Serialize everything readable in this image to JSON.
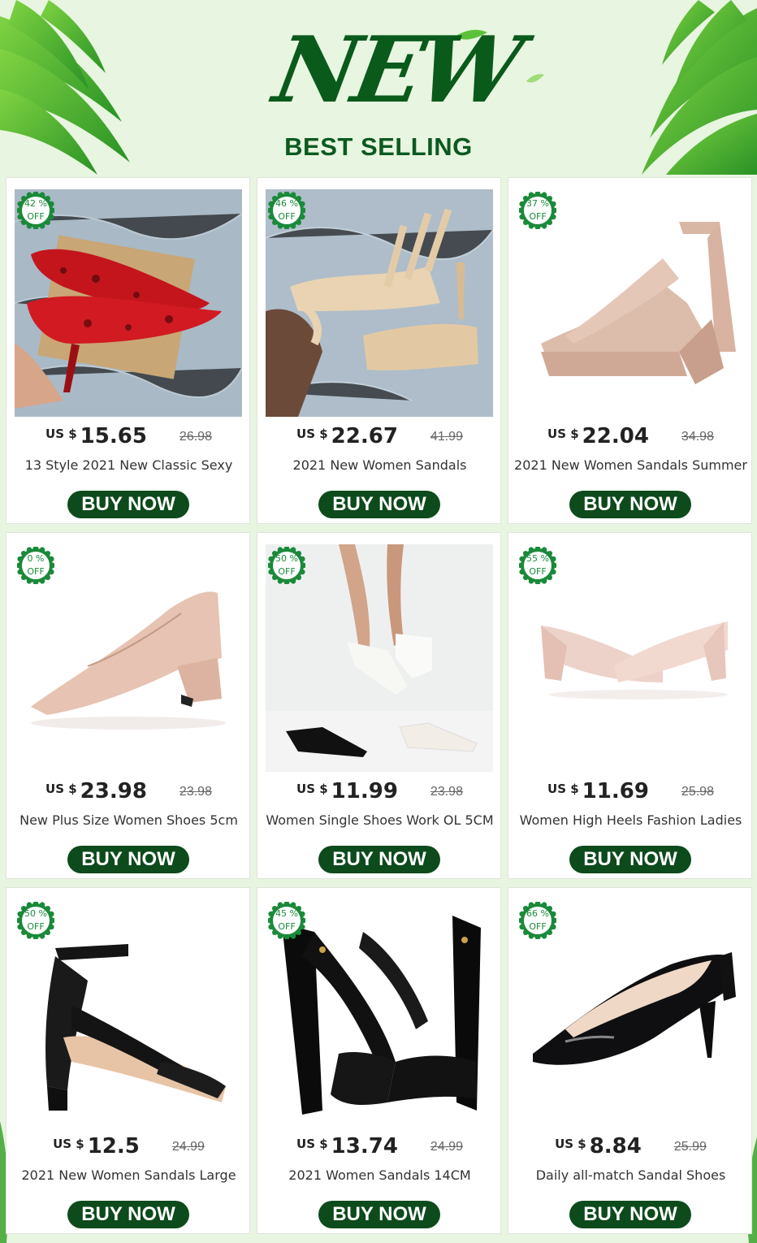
{
  "header": {
    "brand_word": "NEW",
    "subtitle": "BEST SELLING"
  },
  "colors": {
    "page_background": "#e8f5e0",
    "brand_green": "#0a5a1c",
    "button_green": "#0d4a1c",
    "badge_green": "#1a8a3a"
  },
  "products": [
    {
      "discount_percent": "42 %",
      "discount_label": "OFF",
      "currency": "US $",
      "price": "15.65",
      "old_price": "26.98",
      "title": "13 Style 2021 New Classic Sexy",
      "button_label": "BUY NOW"
    },
    {
      "discount_percent": "46 %",
      "discount_label": "OFF",
      "currency": "US $",
      "price": "22.67",
      "old_price": "41.99",
      "title": "2021 New Women Sandals",
      "button_label": "BUY NOW"
    },
    {
      "discount_percent": "37 %",
      "discount_label": "OFF",
      "currency": "US $",
      "price": "22.04",
      "old_price": "34.98",
      "title": "2021 New Women Sandals Summer",
      "button_label": "BUY NOW"
    },
    {
      "discount_percent": "0 %",
      "discount_label": "OFF",
      "currency": "US $",
      "price": "23.98",
      "old_price": "23.98",
      "title": "New Plus Size Women Shoes 5cm",
      "button_label": "BUY NOW"
    },
    {
      "discount_percent": "50 %",
      "discount_label": "OFF",
      "currency": "US $",
      "price": "11.99",
      "old_price": "23.98",
      "title": "Women Single Shoes Work OL 5CM",
      "button_label": "BUY NOW"
    },
    {
      "discount_percent": "55 %",
      "discount_label": "OFF",
      "currency": "US $",
      "price": "11.69",
      "old_price": "25.98",
      "title": "Women High Heels Fashion Ladies",
      "button_label": "BUY NOW"
    },
    {
      "discount_percent": "50 %",
      "discount_label": "OFF",
      "currency": "US $",
      "price": "12.5",
      "old_price": "24.99",
      "title": "2021 New Women Sandals Large",
      "button_label": "BUY NOW"
    },
    {
      "discount_percent": "45 %",
      "discount_label": "OFF",
      "currency": "US $",
      "price": "13.74",
      "old_price": "24.99",
      "title": "2021 Women Sandals 14CM",
      "button_label": "BUY NOW"
    },
    {
      "discount_percent": "66 %",
      "discount_label": "OFF",
      "currency": "US $",
      "price": "8.84",
      "old_price": "25.99",
      "title": "Daily all-match Sandal Shoes",
      "button_label": "BUY NOW"
    }
  ]
}
